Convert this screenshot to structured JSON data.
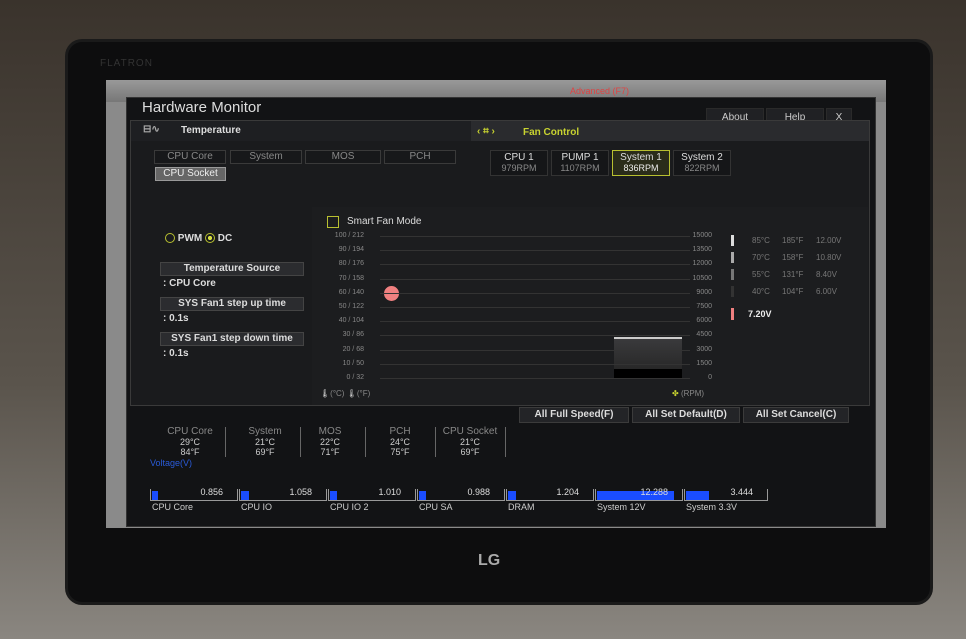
{
  "monitor": {
    "brand": "FLATRON",
    "logo": "LG"
  },
  "bios": {
    "advanced_tab": "Advanced (F7)"
  },
  "window": {
    "title": "Hardware Monitor",
    "about": "About",
    "help": "Help",
    "close": "X"
  },
  "temperature": {
    "header": "Temperature",
    "tabs": [
      "CPU Core",
      "System",
      "MOS",
      "PCH",
      "CPU Socket"
    ],
    "selected": "CPU Socket"
  },
  "fan_control": {
    "header": "Fan Control",
    "fans": [
      {
        "name": "CPU 1",
        "rpm": "979RPM"
      },
      {
        "name": "PUMP 1",
        "rpm": "1107RPM"
      },
      {
        "name": "System 1",
        "rpm": "836RPM",
        "selected": true
      },
      {
        "name": "System 2",
        "rpm": "822RPM"
      }
    ]
  },
  "settings": {
    "pwm": "PWM",
    "dc": "DC",
    "mode_selected": "DC",
    "temp_source_label": "Temperature Source",
    "temp_source_value": ": CPU Core",
    "step_up_label": "SYS Fan1 step up time",
    "step_up_value": ": 0.1s",
    "step_down_label": "SYS Fan1 step down time",
    "step_down_value": ": 0.1s"
  },
  "chart": {
    "smart_fan_label": "Smart Fan Mode",
    "smart_fan_checked": false,
    "left_ticks": [
      "100 / 212",
      "90 / 194",
      "80 / 176",
      "70 / 158",
      "60 / 140",
      "50 / 122",
      "40 / 104",
      "30 /  86",
      "20 /  68",
      "10 /  50",
      "0 /  32"
    ],
    "right_ticks": [
      "15000",
      "13500",
      "12000",
      "10500",
      "9000",
      "7500",
      "6000",
      "4500",
      "3000",
      "1500",
      "0"
    ],
    "unit_c": "(°C)",
    "unit_f": "(°F)",
    "unit_rpm": "(RPM)",
    "point_temp_c": 60,
    "legend": [
      {
        "c": "85°C",
        "f": "185°F",
        "v": "12.00V"
      },
      {
        "c": "70°C",
        "f": "158°F",
        "v": "10.80V"
      },
      {
        "c": "55°C",
        "f": "131°F",
        "v": "8.40V"
      },
      {
        "c": "40°C",
        "f": "104°F",
        "v": "6.00V"
      }
    ],
    "current_voltage": "7.20V",
    "accent": "#f08080"
  },
  "actions": {
    "full_speed": "All Full Speed(F)",
    "set_default": "All Set Default(D)",
    "set_cancel": "All Set Cancel(C)"
  },
  "temps": [
    {
      "name": "CPU Core",
      "c": "29°C",
      "f": "84°F"
    },
    {
      "name": "System",
      "c": "21°C",
      "f": "69°F"
    },
    {
      "name": "MOS",
      "c": "22°C",
      "f": "71°F"
    },
    {
      "name": "PCH",
      "c": "24°C",
      "f": "75°F"
    },
    {
      "name": "CPU Socket",
      "c": "21°C",
      "f": "69°F"
    }
  ],
  "voltage": {
    "title": "Voltage(V)",
    "items": [
      {
        "name": "CPU Core",
        "value": "0.856",
        "fill": 0.07
      },
      {
        "name": "CPU IO",
        "value": "1.058",
        "fill": 0.09
      },
      {
        "name": "CPU IO 2",
        "value": "1.010",
        "fill": 0.08
      },
      {
        "name": "CPU SA",
        "value": "0.988",
        "fill": 0.08
      },
      {
        "name": "DRAM",
        "value": "1.204",
        "fill": 0.1
      },
      {
        "name": "System 12V",
        "value": "12.288",
        "fill": 0.92
      },
      {
        "name": "System 3.3V",
        "value": "3.444",
        "fill": 0.29
      }
    ]
  }
}
